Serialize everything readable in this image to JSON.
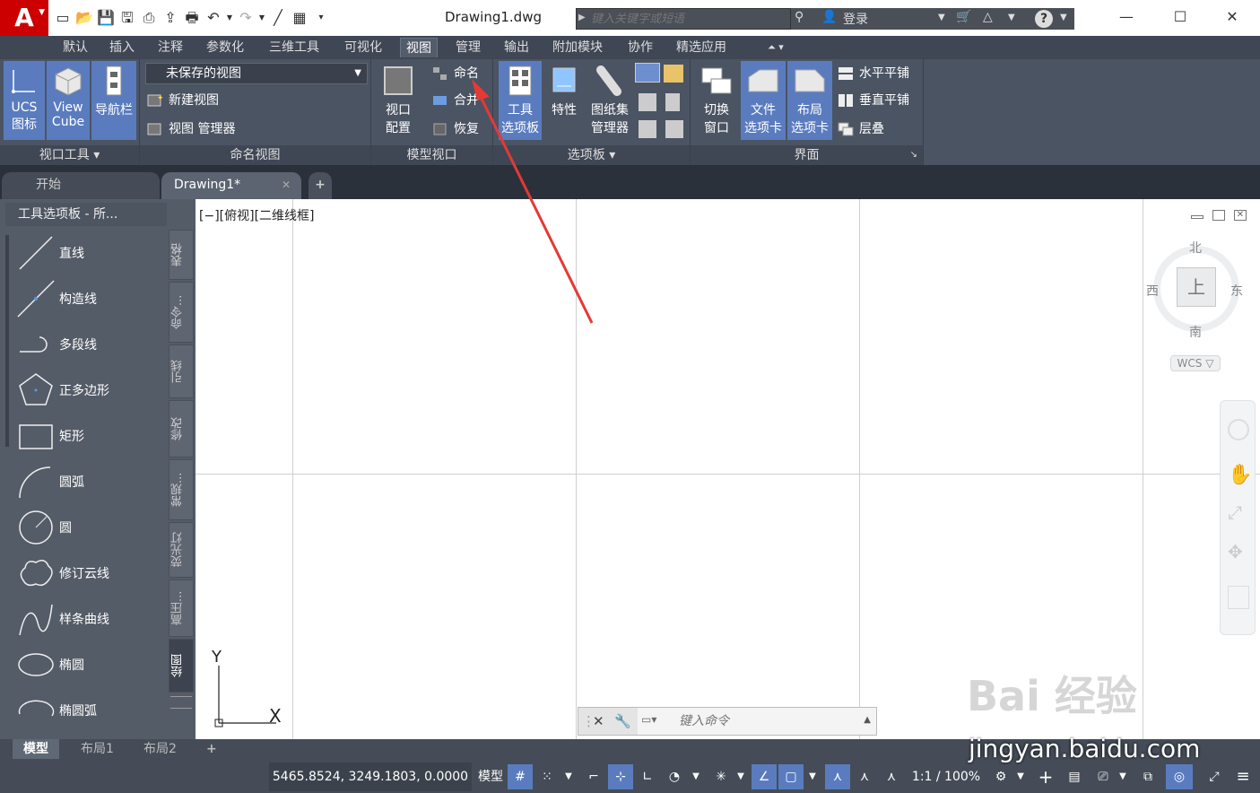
{
  "titlebar": {
    "logo": "A",
    "doc_title": "Drawing1.dwg",
    "search_placeholder": "键入关键字或短语",
    "login": "登录",
    "help": "?"
  },
  "ribbon_tabs": [
    "默认",
    "插入",
    "注释",
    "参数化",
    "三维工具",
    "可视化",
    "视图",
    "管理",
    "输出",
    "附加模块",
    "协作",
    "精选应用"
  ],
  "active_ribbon_tab": "视图",
  "panels": {
    "viewport_tools": {
      "title": "视口工具",
      "ucs_line1": "UCS",
      "ucs_line2": "图标",
      "viewcube_line1": "View",
      "viewcube_line2": "Cube",
      "navbar": "导航栏"
    },
    "named_views": {
      "title": "命名视图",
      "dropdown_value": "未保存的视图",
      "new_view": "新建视图",
      "view_manager": "视图 管理器"
    },
    "model_viewports": {
      "title": "模型视口",
      "viewport_config_line1": "视口",
      "viewport_config_line2": "配置",
      "named": "命名",
      "join": "合并",
      "restore": "恢复"
    },
    "palettes": {
      "title": "选项板",
      "tool_palettes_line1": "工具",
      "tool_palettes_line2": "选项板",
      "properties": "特性",
      "sheet_set_line1": "图纸集",
      "sheet_set_line2": "管理器"
    },
    "interface": {
      "title": "界面",
      "switch_windows_line1": "切换",
      "switch_windows_line2": "窗口",
      "file_tabs_line1": "文件",
      "file_tabs_line2": "选项卡",
      "layout_tabs_line1": "布局",
      "layout_tabs_line2": "选项卡",
      "tile_horizontal": "水平平铺",
      "tile_vertical": "垂直平铺",
      "cascade": "层叠"
    }
  },
  "doc_tabs": {
    "start": "开始",
    "current": "Drawing1*",
    "add": "+"
  },
  "tool_palette": {
    "header": "工具选项板 - 所...",
    "tools": [
      "直线",
      "构造线",
      "多段线",
      "正多边形",
      "矩形",
      "圆弧",
      "圆",
      "修订云线",
      "样条曲线",
      "椭圆",
      "椭圆弧"
    ],
    "vertical_tabs": [
      "表格",
      "命令...",
      "引线",
      "修改",
      "常规...",
      "荧光灯",
      "高压...",
      "绘图"
    ],
    "active_vertical_tab": "绘图"
  },
  "canvas": {
    "viewport_label": "[−][俯视][二维线框]",
    "viewcube": {
      "north": "北",
      "south": "南",
      "east": "东",
      "west": "西",
      "face": "上",
      "wcs": "WCS"
    },
    "ucs_x": "X",
    "ucs_y": "Y"
  },
  "command_line": {
    "placeholder": "键入命令"
  },
  "layout_tabs": [
    "模型",
    "布局1",
    "布局2"
  ],
  "active_layout_tab": "模型",
  "status_bar": {
    "coordinates": "5465.8524, 3249.1803, 0.0000",
    "model": "模型",
    "scale": "1:1 / 100%"
  },
  "watermark": {
    "brand": "Bai 经验",
    "url": "jingyan.baidu.com"
  },
  "colors": {
    "accent": "#5a7cbf",
    "logo_red": "#cc0000",
    "annotation_arrow": "#e53935"
  }
}
